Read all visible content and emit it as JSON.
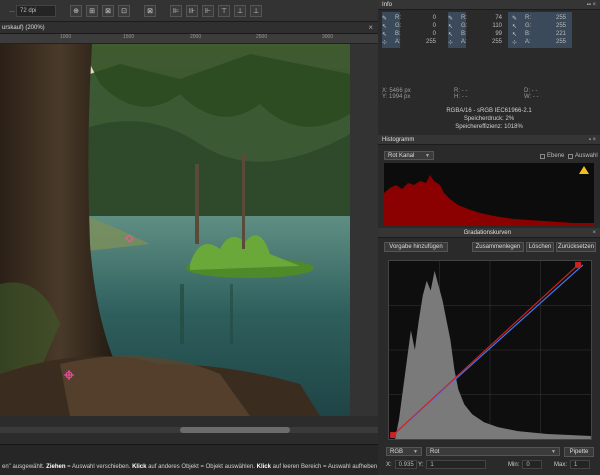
{
  "toolbar": {
    "resolution_value": "72 dpi",
    "grid_icons": [
      "transform-icon",
      "crop-icon",
      "slice-icon",
      "select-icon",
      "mirror-icon"
    ],
    "align_icons": [
      "align-left-icon",
      "align-center-icon",
      "align-right-icon",
      "align-top-icon",
      "align-middle-icon",
      "align-bottom-icon"
    ]
  },
  "document": {
    "tab_title": "urskauf) (200%)",
    "ruler_ticks": [
      "1000",
      "1500",
      "2000",
      "2500",
      "3000"
    ]
  },
  "info_panel": {
    "title": "Info",
    "col1": {
      "R": "0",
      "G": "0",
      "B": "0",
      "A": "255"
    },
    "col2": {
      "R": "74",
      "G": "110",
      "B": "99",
      "A": "255"
    },
    "col3": {
      "R": "255",
      "G": "255",
      "B": "221",
      "A": "255"
    },
    "coords": {
      "x_label": "X:",
      "x_value": "5466 px",
      "y_label": "Y:",
      "y_value": "1994 px"
    },
    "hsl": {
      "R": "- -",
      "H": "- -",
      "D": "- -",
      "W": "- -"
    },
    "color_profile": "RGBA/16 - sRGB IEC61966-2.1",
    "memory_usage": "Speicherdruck: 2%",
    "memory_efficiency": "Speichereffizienz: 1018%"
  },
  "histogram_panel": {
    "title": "Histogramm",
    "channel_selected": "Rot Kanal",
    "opt_marked": "Ebene",
    "opt_selection": "Auswahl",
    "warning_icon": "warning-icon",
    "fill_color": "#8b0000"
  },
  "curves_panel": {
    "title": "Gradationskurven",
    "buttons": {
      "add_preset": "Vorgabe hinzufügen",
      "merge": "Zusammenlegen",
      "delete": "Löschen",
      "reset": "Zurücksetzen"
    },
    "channel_mode": "RGB",
    "channel": "Rot",
    "pipette_label": "Pipette",
    "x_label": "X:",
    "x_value": "0.935",
    "y_label": "Y:",
    "y_value": "1",
    "min_label": "Min:",
    "min_value": "0",
    "max_label": "Max:",
    "max_value": "1",
    "curve_red_color": "#cc2222",
    "curve_blue_color": "#4477ee"
  },
  "status": {
    "text_a": "en\" ausgewählt. ",
    "bold_a": "Ziehen",
    "text_b": " = Auswahl verschieben. ",
    "bold_b": "Klick",
    "text_c": " auf anderes Objekt = Objekt auswählen. ",
    "bold_c": "Klick",
    "text_d": " auf leeren Bereich = Auswahl aufheben"
  }
}
